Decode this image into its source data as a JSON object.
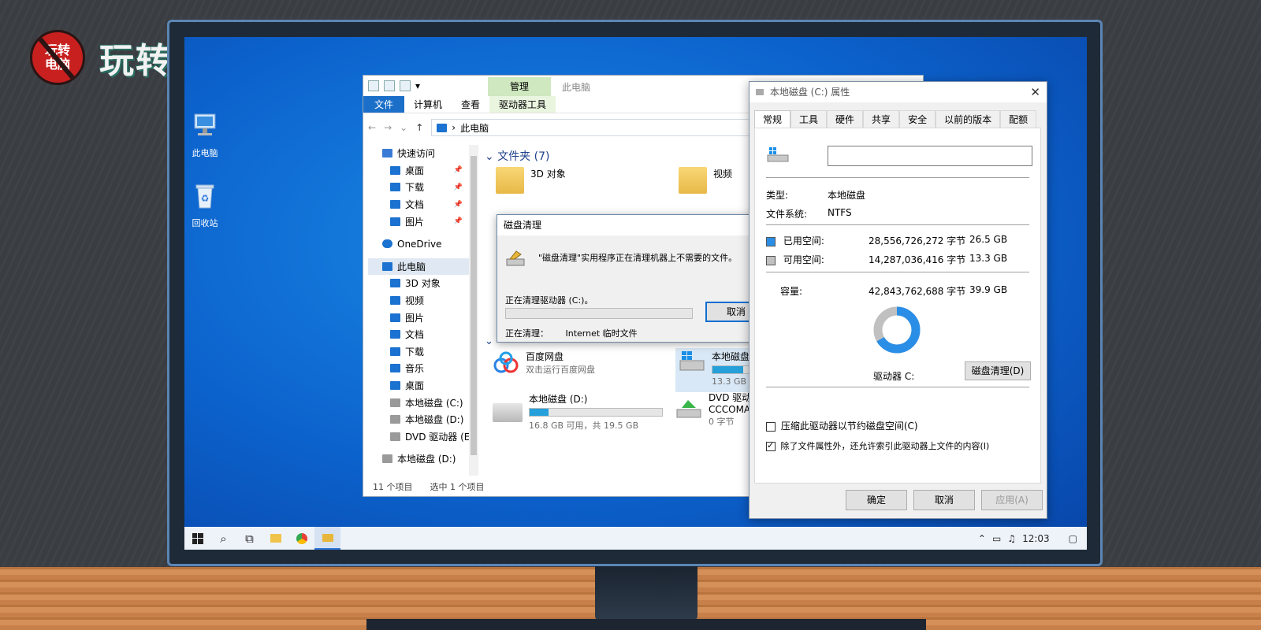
{
  "brand": {
    "badge": "玩转\n电脑",
    "title": "玩转电脑"
  },
  "desktop": {
    "icons": [
      {
        "label": "此电脑"
      },
      {
        "label": "回收站"
      }
    ]
  },
  "explorer": {
    "ribbon_manage": "管理",
    "ribbon_title": "此电脑",
    "tabs": [
      "文件",
      "计算机",
      "查看",
      "驱动器工具"
    ],
    "address": "此电脑",
    "nav": [
      {
        "label": "快速访问",
        "level": 0,
        "icon": "star-icon"
      },
      {
        "label": "桌面",
        "pinned": true,
        "icon": "desktop-icon"
      },
      {
        "label": "下载",
        "pinned": true,
        "icon": "download-icon"
      },
      {
        "label": "文档",
        "pinned": true,
        "icon": "document-icon"
      },
      {
        "label": "图片",
        "pinned": true,
        "icon": "picture-icon"
      },
      {
        "label": "OneDrive",
        "level": 0,
        "icon": "cloud-icon"
      },
      {
        "label": "此电脑",
        "level": 0,
        "selected": true,
        "icon": "computer-icon"
      },
      {
        "label": "3D 对象",
        "icon": "cube-icon"
      },
      {
        "label": "视频",
        "icon": "video-icon"
      },
      {
        "label": "图片",
        "icon": "picture-icon"
      },
      {
        "label": "文档",
        "icon": "document-icon"
      },
      {
        "label": "下载",
        "icon": "download-icon"
      },
      {
        "label": "音乐",
        "icon": "music-icon"
      },
      {
        "label": "桌面",
        "icon": "desktop-icon"
      },
      {
        "label": "本地磁盘 (C:)",
        "icon": "drive-icon"
      },
      {
        "label": "本地磁盘 (D:)",
        "icon": "drive-icon"
      },
      {
        "label": "DVD 驱动器 (E:)",
        "icon": "dvd-icon"
      },
      {
        "label": "本地磁盘 (D:)",
        "level": 0,
        "icon": "drive-icon"
      }
    ],
    "folders_header": "文件夹 (7)",
    "folders": [
      "3D 对象",
      "视频"
    ],
    "devices": {
      "baidu": {
        "name": "百度网盘",
        "sub": "双击运行百度网盘"
      },
      "c_drive": {
        "name": "本地磁盘",
        "free": "13.3 GB",
        "fill": 0.67
      },
      "d_drive": {
        "name": "本地磁盘 (D:)",
        "free": "16.8 GB 可用，共 19.5 GB",
        "fill": 0.14
      },
      "dvd": {
        "name": "DVD 驱动",
        "sub1": "CCCOMA",
        "sub2": "0 字节"
      }
    },
    "status": {
      "count": "11 个项目",
      "selected": "选中 1 个项目"
    }
  },
  "cleanup": {
    "title": "磁盘清理",
    "message": "\"磁盘清理\"实用程序正在清理机器上不需要的文件。",
    "progress_label": "正在清理驱动器 (C:)。",
    "cancel": "取消",
    "current_label": "正在清理：",
    "current_value": "Internet 临时文件",
    "progress": 0.0
  },
  "props": {
    "title": "本地磁盘 (C:) 属性",
    "tabs": [
      "常规",
      "工具",
      "硬件",
      "共享",
      "安全",
      "以前的版本",
      "配额"
    ],
    "name_value": "",
    "type_label": "类型:",
    "type_value": "本地磁盘",
    "fs_label": "文件系统:",
    "fs_value": "NTFS",
    "used_label": "已用空间:",
    "used_bytes": "28,556,726,272 字节",
    "used_gb": "26.5 GB",
    "free_label": "可用空间:",
    "free_bytes": "14,287,036,416 字节",
    "free_gb": "13.3 GB",
    "cap_label": "容量:",
    "cap_bytes": "42,843,762,688 字节",
    "cap_gb": "39.9 GB",
    "used_fraction": 0.667,
    "drive_label": "驱动器 C:",
    "cleanup_btn": "磁盘清理(D)",
    "chk1": "压缩此驱动器以节约磁盘空间(C)",
    "chk2": "除了文件属性外，还允许索引此驱动器上文件的内容(I)",
    "ok": "确定",
    "cancel": "取消",
    "apply": "应用(A)",
    "colors": {
      "used": "#2b8ee6",
      "free": "#c0c0c0"
    }
  },
  "taskbar": {
    "time": "12:03"
  }
}
